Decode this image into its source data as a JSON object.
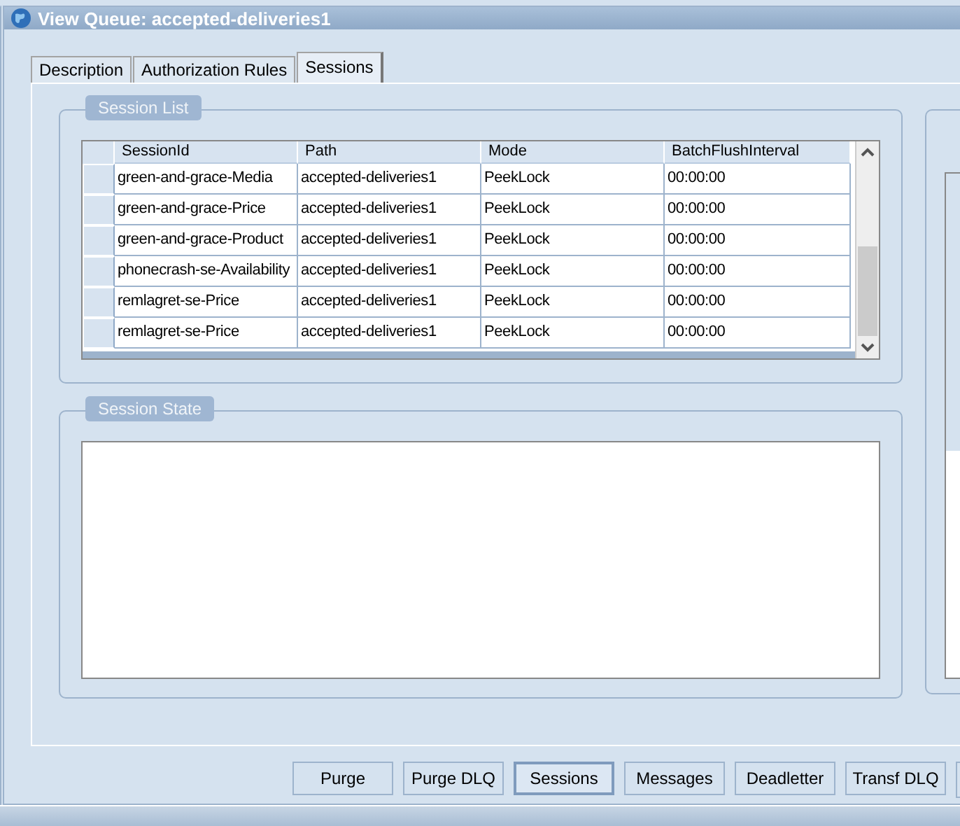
{
  "window": {
    "title": "View Queue: accepted-deliveries1"
  },
  "tabs": [
    {
      "label": "Description",
      "selected": false
    },
    {
      "label": "Authorization Rules",
      "selected": false
    },
    {
      "label": "Sessions",
      "selected": true
    }
  ],
  "session_list": {
    "title": "Session List",
    "columns": [
      "SessionId",
      "Path",
      "Mode",
      "BatchFlushInterval"
    ],
    "rows": [
      {
        "cells": [
          "green-and-grace-Media",
          "accepted-deliveries1",
          "PeekLock",
          "00:00:00"
        ]
      },
      {
        "cells": [
          "green-and-grace-Price",
          "accepted-deliveries1",
          "PeekLock",
          "00:00:00"
        ]
      },
      {
        "cells": [
          "green-and-grace-Product",
          "accepted-deliveries1",
          "PeekLock",
          "00:00:00"
        ]
      },
      {
        "cells": [
          "phonecrash-se-Availability",
          "accepted-deliveries1",
          "PeekLock",
          "00:00:00"
        ]
      },
      {
        "cells": [
          "remlagret-se-Price",
          "accepted-deliveries1",
          "PeekLock",
          "00:00:00"
        ]
      },
      {
        "cells": [
          "remlagret-se-Price",
          "accepted-deliveries1",
          "PeekLock",
          "00:00:00"
        ]
      }
    ]
  },
  "session_state": {
    "title": "Session State"
  },
  "buttons": [
    {
      "label": "Purge",
      "selected": false
    },
    {
      "label": "Purge DLQ",
      "selected": false
    },
    {
      "label": "Sessions",
      "selected": true
    },
    {
      "label": "Messages",
      "selected": false
    },
    {
      "label": "Deadletter",
      "selected": false
    },
    {
      "label": "Transf DLQ",
      "selected": false
    }
  ]
}
